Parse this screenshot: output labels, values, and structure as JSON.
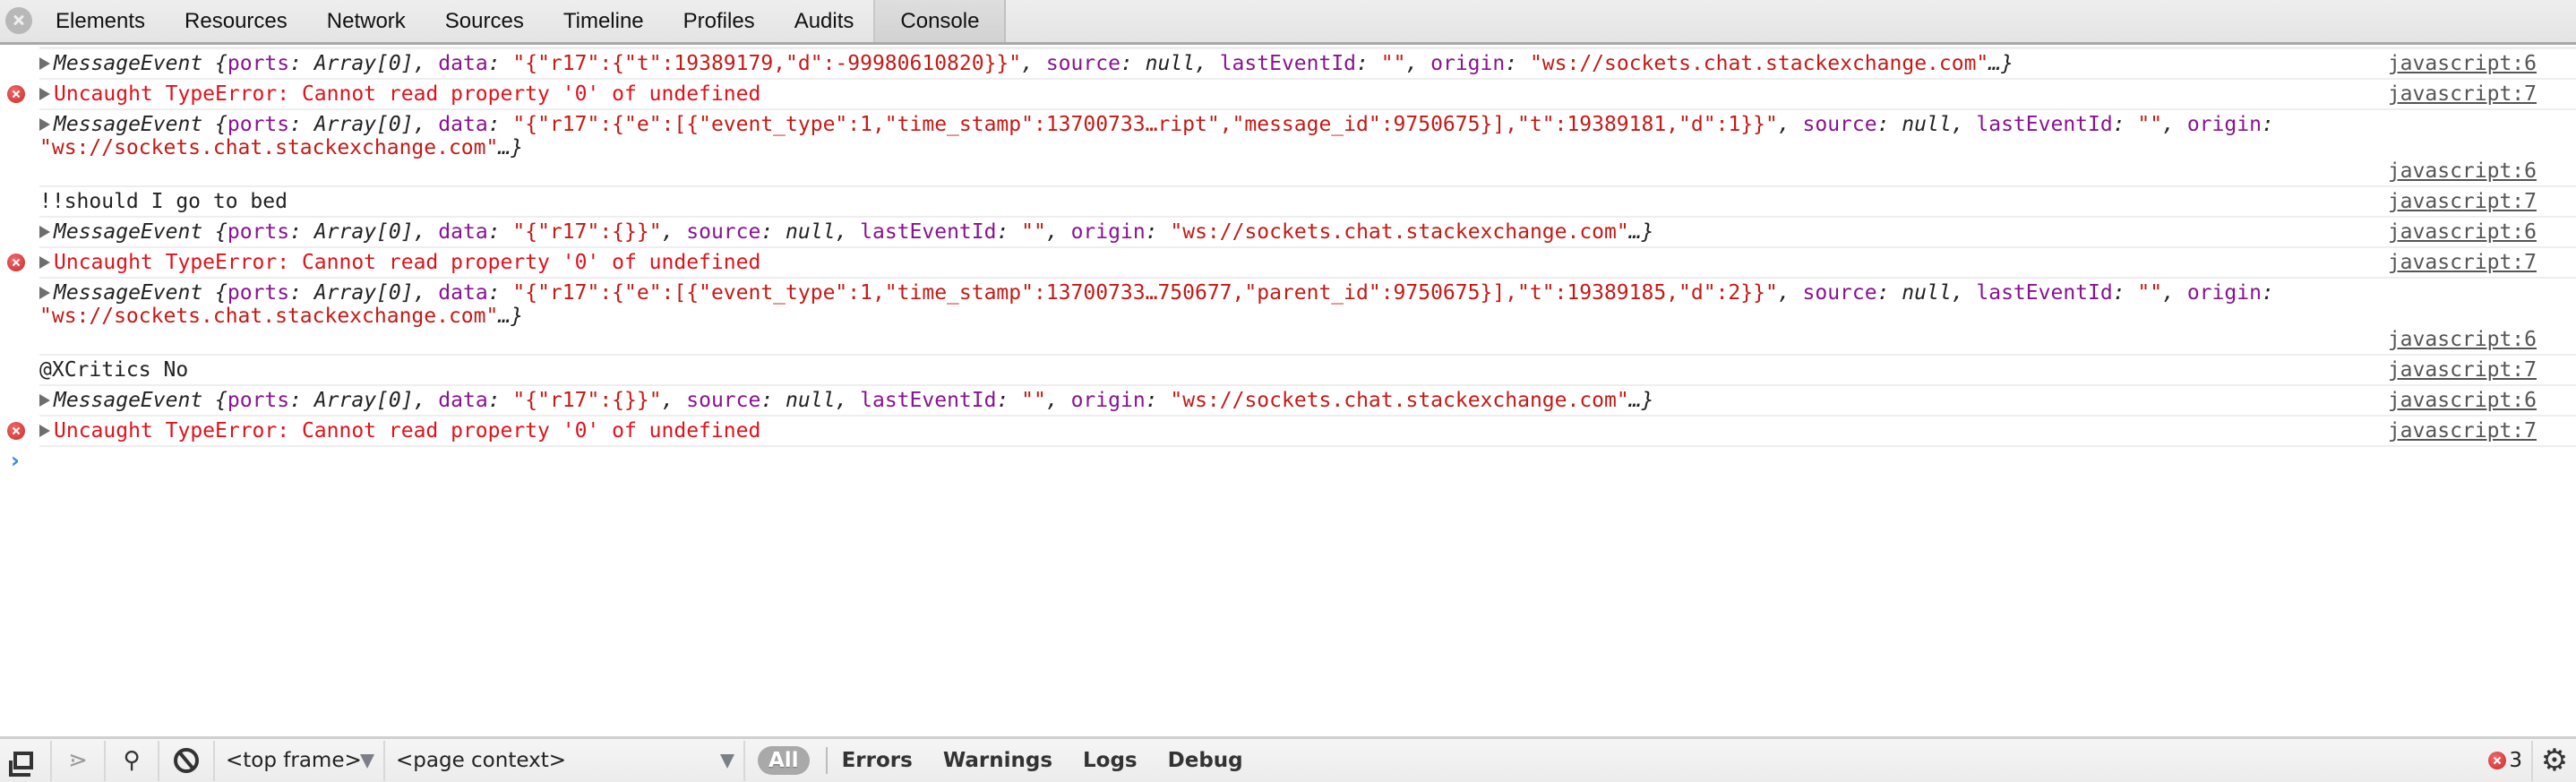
{
  "tabbar": {
    "tabs": [
      {
        "label": "Elements"
      },
      {
        "label": "Resources"
      },
      {
        "label": "Network"
      },
      {
        "label": "Sources"
      },
      {
        "label": "Timeline"
      },
      {
        "label": "Profiles"
      },
      {
        "label": "Audits"
      },
      {
        "label": "Console",
        "active": true
      }
    ]
  },
  "console": {
    "messages": [
      {
        "type": "object",
        "parts": [
          {
            "cls": "obj",
            "t": "MessageEvent {"
          },
          {
            "cls": "k",
            "t": "ports"
          },
          {
            "cls": "obj",
            "t": ": Array[0], "
          },
          {
            "cls": "k",
            "t": "data"
          },
          {
            "cls": "obj",
            "t": ": "
          },
          {
            "cls": "s",
            "t": "\"{\"r17\":{\"t\":19389179,\"d\":-99980610820}}\""
          },
          {
            "cls": "obj",
            "t": ", "
          },
          {
            "cls": "k",
            "t": "source"
          },
          {
            "cls": "obj",
            "t": ": null, "
          },
          {
            "cls": "k",
            "t": "lastEventId"
          },
          {
            "cls": "obj",
            "t": ": "
          },
          {
            "cls": "s",
            "t": "\"\""
          },
          {
            "cls": "obj",
            "t": ", "
          },
          {
            "cls": "k",
            "t": "origin"
          },
          {
            "cls": "obj",
            "t": ": "
          },
          {
            "cls": "s",
            "t": "\"ws://sockets.chat.stackexchange.com\""
          },
          {
            "cls": "obj",
            "t": "…}"
          }
        ],
        "link": "javascript:6"
      },
      {
        "type": "error",
        "text": "Uncaught TypeError: Cannot read property '0' of undefined",
        "link": "javascript:7"
      },
      {
        "type": "object",
        "multi": true,
        "parts": [
          {
            "cls": "obj",
            "t": "MessageEvent {"
          },
          {
            "cls": "k",
            "t": "ports"
          },
          {
            "cls": "obj",
            "t": ": Array[0], "
          },
          {
            "cls": "k",
            "t": "data"
          },
          {
            "cls": "obj",
            "t": ": "
          },
          {
            "cls": "s",
            "t": "\"{\"r17\":{\"e\":[{\"event_type\":1,\"time_stamp\":13700733…ript\",\"message_id\":9750675}],\"t\":19389181,\"d\":1}}\""
          },
          {
            "cls": "obj",
            "t": ", "
          },
          {
            "cls": "k",
            "t": "source"
          },
          {
            "cls": "obj",
            "t": ": null, "
          },
          {
            "cls": "k",
            "t": "lastEventId"
          },
          {
            "cls": "obj",
            "t": ": "
          },
          {
            "cls": "s",
            "t": "\"\""
          },
          {
            "cls": "obj",
            "t": ", "
          },
          {
            "cls": "k",
            "t": "origin"
          },
          {
            "cls": "obj",
            "t": ": "
          },
          {
            "cls": "s",
            "t": "\"ws://sockets.chat.stackexchange.com\""
          },
          {
            "cls": "obj",
            "t": "…}"
          }
        ],
        "link": "javascript:6"
      },
      {
        "type": "log",
        "text": "!!should I go to bed",
        "link": "javascript:7"
      },
      {
        "type": "object",
        "parts": [
          {
            "cls": "obj",
            "t": "MessageEvent {"
          },
          {
            "cls": "k",
            "t": "ports"
          },
          {
            "cls": "obj",
            "t": ": Array[0], "
          },
          {
            "cls": "k",
            "t": "data"
          },
          {
            "cls": "obj",
            "t": ": "
          },
          {
            "cls": "s",
            "t": "\"{\"r17\":{}}\""
          },
          {
            "cls": "obj",
            "t": ", "
          },
          {
            "cls": "k",
            "t": "source"
          },
          {
            "cls": "obj",
            "t": ": null, "
          },
          {
            "cls": "k",
            "t": "lastEventId"
          },
          {
            "cls": "obj",
            "t": ": "
          },
          {
            "cls": "s",
            "t": "\"\""
          },
          {
            "cls": "obj",
            "t": ", "
          },
          {
            "cls": "k",
            "t": "origin"
          },
          {
            "cls": "obj",
            "t": ": "
          },
          {
            "cls": "s",
            "t": "\"ws://sockets.chat.stackexchange.com\""
          },
          {
            "cls": "obj",
            "t": "…}"
          }
        ],
        "link": "javascript:6"
      },
      {
        "type": "error",
        "text": "Uncaught TypeError: Cannot read property '0' of undefined",
        "link": "javascript:7"
      },
      {
        "type": "object",
        "multi": true,
        "parts": [
          {
            "cls": "obj",
            "t": "MessageEvent {"
          },
          {
            "cls": "k",
            "t": "ports"
          },
          {
            "cls": "obj",
            "t": ": Array[0], "
          },
          {
            "cls": "k",
            "t": "data"
          },
          {
            "cls": "obj",
            "t": ": "
          },
          {
            "cls": "s",
            "t": "\"{\"r17\":{\"e\":[{\"event_type\":1,\"time_stamp\":13700733…750677,\"parent_id\":9750675}],\"t\":19389185,\"d\":2}}\""
          },
          {
            "cls": "obj",
            "t": ", "
          },
          {
            "cls": "k",
            "t": "source"
          },
          {
            "cls": "obj",
            "t": ": null, "
          },
          {
            "cls": "k",
            "t": "lastEventId"
          },
          {
            "cls": "obj",
            "t": ": "
          },
          {
            "cls": "s",
            "t": "\"\""
          },
          {
            "cls": "obj",
            "t": ", "
          },
          {
            "cls": "k",
            "t": "origin"
          },
          {
            "cls": "obj",
            "t": ": "
          },
          {
            "cls": "s",
            "t": "\"ws://sockets.chat.stackexchange.com\""
          },
          {
            "cls": "obj",
            "t": "…}"
          }
        ],
        "link": "javascript:6"
      },
      {
        "type": "log",
        "text": "@XCritics No",
        "link": "javascript:7"
      },
      {
        "type": "object",
        "parts": [
          {
            "cls": "obj",
            "t": "MessageEvent {"
          },
          {
            "cls": "k",
            "t": "ports"
          },
          {
            "cls": "obj",
            "t": ": Array[0], "
          },
          {
            "cls": "k",
            "t": "data"
          },
          {
            "cls": "obj",
            "t": ": "
          },
          {
            "cls": "s",
            "t": "\"{\"r17\":{}}\""
          },
          {
            "cls": "obj",
            "t": ", "
          },
          {
            "cls": "k",
            "t": "source"
          },
          {
            "cls": "obj",
            "t": ": null, "
          },
          {
            "cls": "k",
            "t": "lastEventId"
          },
          {
            "cls": "obj",
            "t": ": "
          },
          {
            "cls": "s",
            "t": "\"\""
          },
          {
            "cls": "obj",
            "t": ", "
          },
          {
            "cls": "k",
            "t": "origin"
          },
          {
            "cls": "obj",
            "t": ": "
          },
          {
            "cls": "s",
            "t": "\"ws://sockets.chat.stackexchange.com\""
          },
          {
            "cls": "obj",
            "t": "…}"
          }
        ],
        "link": "javascript:6"
      },
      {
        "type": "error",
        "text": "Uncaught TypeError: Cannot read property '0' of undefined",
        "link": "javascript:7"
      }
    ],
    "prompt_value": ""
  },
  "bottombar": {
    "frame_select": "<top frame>",
    "context_select": "<page context>",
    "filters": {
      "all": "All",
      "errors": "Errors",
      "warnings": "Warnings",
      "logs": "Logs",
      "debug": "Debug"
    },
    "error_count": "3"
  },
  "colors": {
    "error_text": "#e0121b",
    "property_key": "#881391",
    "string_value": "#c41a16",
    "prompt": "#3a84e0",
    "error_badge": "#cc2a2a"
  }
}
